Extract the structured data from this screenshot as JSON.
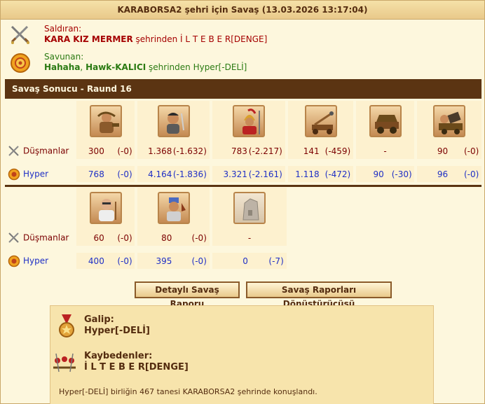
{
  "title": "KARABORSA2 şehri için Savaş (13.03.2026 13:17:04)",
  "attacker": {
    "label": "Saldıran:",
    "player": "KARA KIZ MERMER",
    "suffix_text": " şehrinden İ L T E B E R[DENGE]",
    "icon": "crossed-swords-icon"
  },
  "defender": {
    "label": "Savunan:",
    "player1": "Hahaha",
    "separator": ", ",
    "player2": "Hawk-KALICI",
    "suffix_text": " şehrinden Hyper[-DELİ]",
    "icon": "shield-icon"
  },
  "result_header": "Savaş Sonucu - Raund 16",
  "table1": {
    "units": [
      "unit-hoplite-slinger",
      "unit-swordsman",
      "unit-spartan",
      "unit-catapult",
      "unit-ram",
      "unit-mortar"
    ],
    "enemy": {
      "name": "Düşmanlar",
      "cells": [
        {
          "num": "300",
          "diff": "(-0)"
        },
        {
          "num": "1.368",
          "diff": "(-1.632)"
        },
        {
          "num": "783",
          "diff": "(-2.217)"
        },
        {
          "num": "141",
          "diff": "(-459)"
        },
        {
          "num": "-",
          "diff": ""
        },
        {
          "num": "90",
          "diff": "(-0)"
        }
      ]
    },
    "own": {
      "name": "Hyper",
      "cells": [
        {
          "num": "768",
          "diff": "(-0)"
        },
        {
          "num": "4.164",
          "diff": "(-1.836)"
        },
        {
          "num": "3.321",
          "diff": "(-2.161)"
        },
        {
          "num": "1.118",
          "diff": "(-472)"
        },
        {
          "num": "90",
          "diff": "(-30)"
        },
        {
          "num": "96",
          "diff": "(-0)"
        }
      ]
    }
  },
  "table2": {
    "units": [
      "unit-doctor",
      "unit-cook",
      "unit-wall"
    ],
    "enemy": {
      "name": "Düşmanlar",
      "cells": [
        {
          "num": "60",
          "diff": "(-0)"
        },
        {
          "num": "80",
          "diff": "(-0)"
        },
        {
          "num": "-",
          "diff": ""
        }
      ]
    },
    "own": {
      "name": "Hyper",
      "cells": [
        {
          "num": "400",
          "diff": "(-0)"
        },
        {
          "num": "395",
          "diff": "(-0)"
        },
        {
          "num": "0",
          "diff": "(-7)"
        }
      ]
    }
  },
  "buttons": {
    "detailed_report": "Detaylı Savaş Raporu",
    "converter": "Savaş Raporları Dönüştürücüsü"
  },
  "summary": {
    "winner_heading": "Galip:",
    "winner": "Hyper[-DELİ]",
    "loser_heading": "Kaybedenler:",
    "loser": "İ L T E B E R[DENGE]",
    "note": "Hyper[-DELİ] birliğin 467 tanesi KARABORSA2 şehrinde konuşlandı."
  },
  "colors": {
    "header_bg": "#5b3412",
    "enemy_text": "#7b0000",
    "own_text": "#1f2fc5",
    "attacker_text": "#a50000",
    "defender_text": "#2a7a12"
  }
}
